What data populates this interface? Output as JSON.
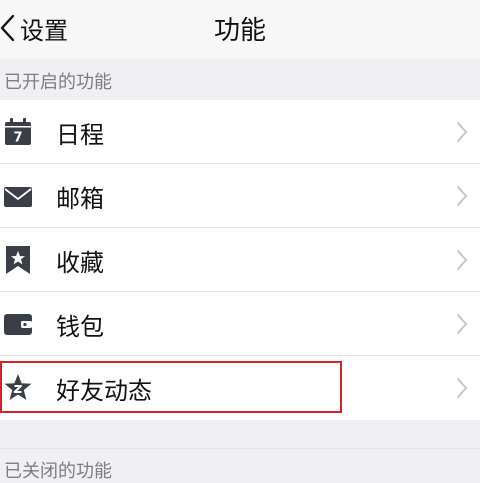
{
  "nav": {
    "back_label": "设置",
    "title": "功能"
  },
  "sections": {
    "enabled_header": "已开启的功能",
    "disabled_header": "已关闭的功能"
  },
  "features": [
    {
      "label": "日程",
      "icon": "calendar-icon",
      "calendar_day": "7"
    },
    {
      "label": "邮箱",
      "icon": "mail-icon"
    },
    {
      "label": "收藏",
      "icon": "bookmark-star-icon"
    },
    {
      "label": "钱包",
      "icon": "wallet-icon"
    },
    {
      "label": "好友动态",
      "icon": "qzone-star-icon",
      "highlighted": true
    }
  ],
  "colors": {
    "icon": "#3a3f47",
    "highlight_border": "#d8202c",
    "chevron": "#c7c7cc",
    "section_text": "#7d7d82"
  }
}
